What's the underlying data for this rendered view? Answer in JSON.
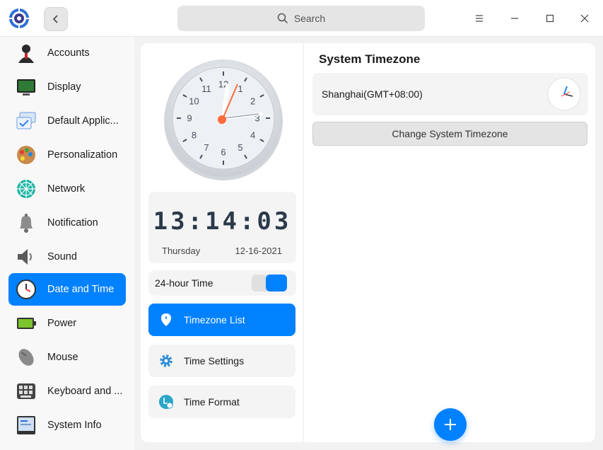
{
  "titlebar": {
    "search_placeholder": "Search",
    "back_icon": "chevron-left-icon",
    "menu_icon": "menu-icon",
    "minimize_icon": "minimize-icon",
    "maximize_icon": "maximize-icon",
    "close_icon": "close-icon"
  },
  "sidebar": {
    "items": [
      {
        "label": "Accounts",
        "icon": "accounts-icon"
      },
      {
        "label": "Display",
        "icon": "display-icon"
      },
      {
        "label": "Default Applic...",
        "icon": "default-applications-icon"
      },
      {
        "label": "Personalization",
        "icon": "personalization-icon"
      },
      {
        "label": "Network",
        "icon": "network-icon"
      },
      {
        "label": "Notification",
        "icon": "notification-icon"
      },
      {
        "label": "Sound",
        "icon": "sound-icon"
      },
      {
        "label": "Date and Time",
        "icon": "date-time-icon",
        "active": true
      },
      {
        "label": "Power",
        "icon": "power-icon"
      },
      {
        "label": "Mouse",
        "icon": "mouse-icon"
      },
      {
        "label": "Keyboard and ...",
        "icon": "keyboard-icon"
      },
      {
        "label": "System Info",
        "icon": "system-info-icon"
      }
    ]
  },
  "clock": {
    "time": "13:14:03",
    "day": "Thursday",
    "date": "12-16-2021",
    "dial_numbers": [
      "12",
      "1",
      "2",
      "3",
      "4",
      "5",
      "6",
      "7",
      "8",
      "9",
      "10",
      "11"
    ]
  },
  "toggle_24h": {
    "label": "24-hour Time",
    "on": true
  },
  "nav": {
    "timezone_list": "Timezone List",
    "time_settings": "Time Settings",
    "time_format": "Time Format"
  },
  "timezone": {
    "section_title": "System Timezone",
    "name": "Shanghai(GMT+08:00)",
    "change_button": "Change System Timezone"
  },
  "colors": {
    "accent": "#0081ff",
    "second_hand": "#ff6a3d"
  }
}
